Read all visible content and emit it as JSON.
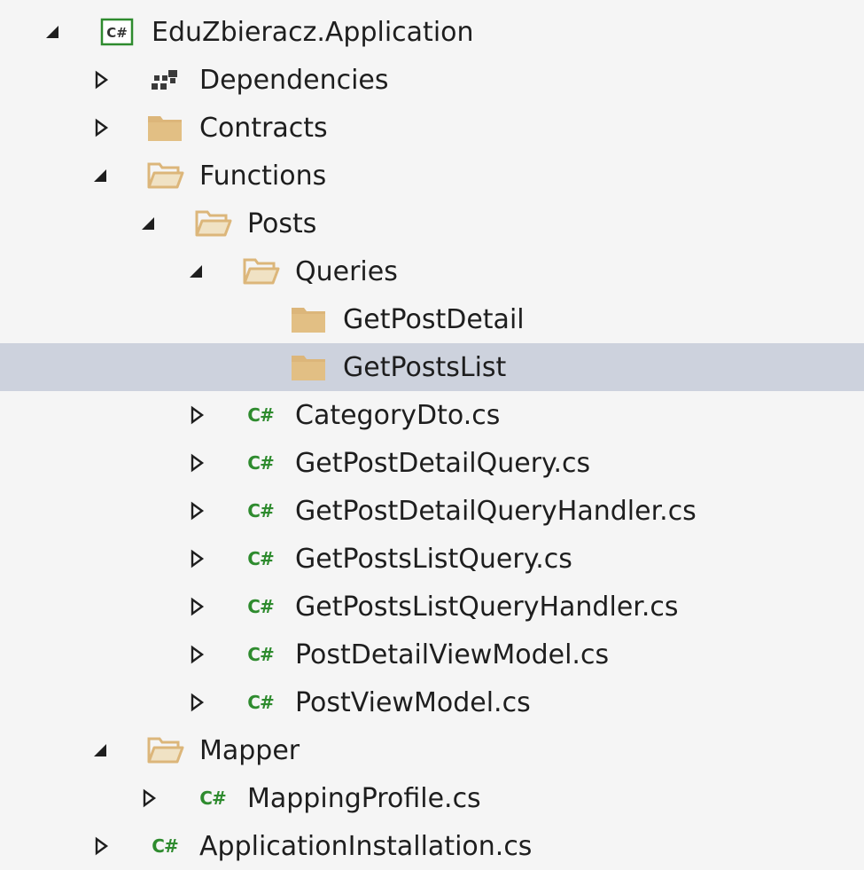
{
  "colors": {
    "background": "#f5f5f5",
    "selection": "#cdd2dd",
    "folder": "#dcb67a",
    "csharp": "#2e8b2e",
    "text": "#1e1e1e"
  },
  "tree": {
    "selected_label": "GetPostsList",
    "items": [
      {
        "label": "EduZbieracz.Application",
        "icon": "csharp-project-icon",
        "icon_text": "C#",
        "expanded": true,
        "level": 0
      },
      {
        "label": "Dependencies",
        "icon": "dependencies-icon",
        "expanded": false,
        "level": 1
      },
      {
        "label": "Contracts",
        "icon": "folder-closed-icon",
        "expanded": false,
        "level": 1
      },
      {
        "label": "Functions",
        "icon": "folder-open-icon",
        "expanded": true,
        "level": 1
      },
      {
        "label": "Posts",
        "icon": "folder-open-icon",
        "expanded": true,
        "level": 2
      },
      {
        "label": "Queries",
        "icon": "folder-open-icon",
        "expanded": true,
        "level": 3
      },
      {
        "label": "GetPostDetail",
        "icon": "folder-closed-icon",
        "expanded": null,
        "level": 4
      },
      {
        "label": "GetPostsList",
        "icon": "folder-closed-icon",
        "expanded": null,
        "level": 4,
        "selected": true
      },
      {
        "label": "CategoryDto.cs",
        "icon": "csharp-file-icon",
        "icon_text": "C#",
        "expanded": false,
        "level": 3
      },
      {
        "label": "GetPostDetailQuery.cs",
        "icon": "csharp-file-icon",
        "icon_text": "C#",
        "expanded": false,
        "level": 3
      },
      {
        "label": "GetPostDetailQueryHandler.cs",
        "icon": "csharp-file-icon",
        "icon_text": "C#",
        "expanded": false,
        "level": 3
      },
      {
        "label": "GetPostsListQuery.cs",
        "icon": "csharp-file-icon",
        "icon_text": "C#",
        "expanded": false,
        "level": 3
      },
      {
        "label": "GetPostsListQueryHandler.cs",
        "icon": "csharp-file-icon",
        "icon_text": "C#",
        "expanded": false,
        "level": 3
      },
      {
        "label": "PostDetailViewModel.cs",
        "icon": "csharp-file-icon",
        "icon_text": "C#",
        "expanded": false,
        "level": 3
      },
      {
        "label": "PostViewModel.cs",
        "icon": "csharp-file-icon",
        "icon_text": "C#",
        "expanded": false,
        "level": 3
      },
      {
        "label": "Mapper",
        "icon": "folder-open-icon",
        "expanded": true,
        "level": 1
      },
      {
        "label": "MappingProfile.cs",
        "icon": "csharp-file-icon",
        "icon_text": "C#",
        "expanded": false,
        "level": 2
      },
      {
        "label": "ApplicationInstallation.cs",
        "icon": "csharp-file-icon",
        "icon_text": "C#",
        "expanded": false,
        "level": 1
      }
    ]
  }
}
